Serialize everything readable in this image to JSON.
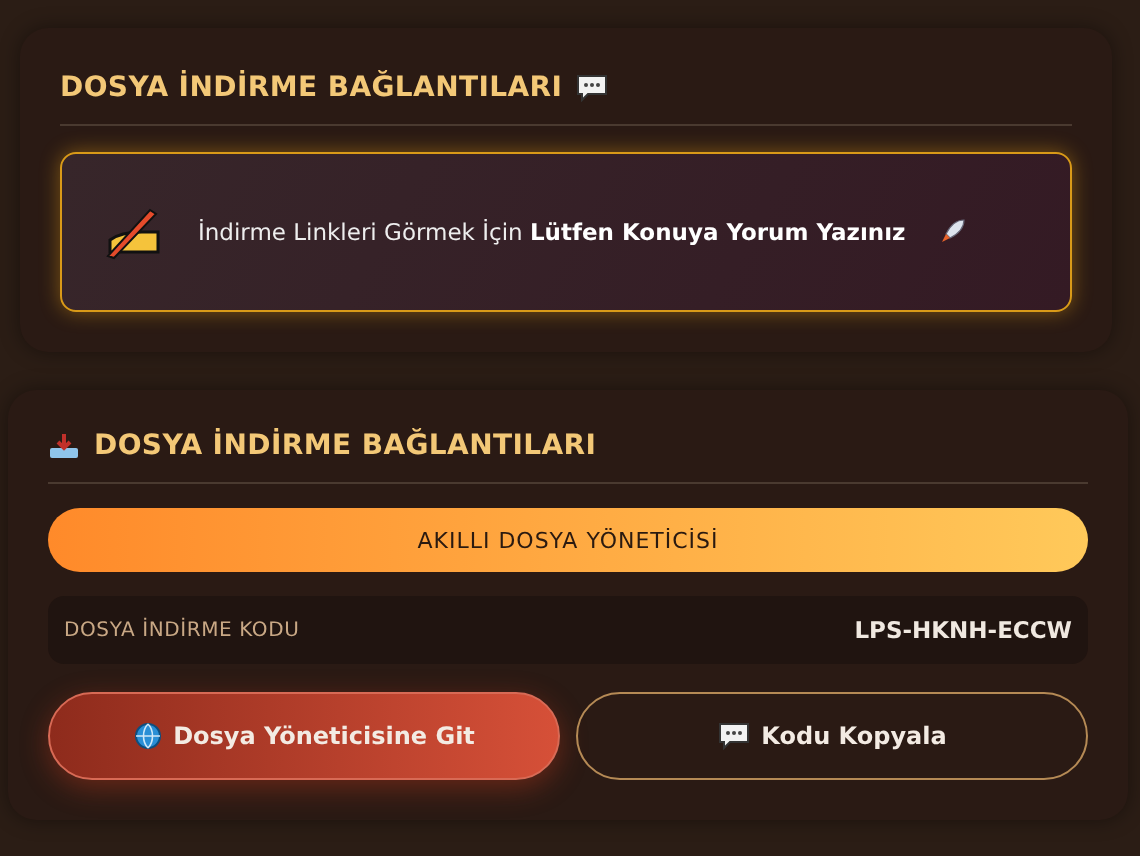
{
  "comment_panel": {
    "title": "DOSYA İNDİRME BAĞLANTILARI",
    "notice": "İndirme Linkleri Görmek İçin **Lütfen Konuya Yorum Yazınız**"
  },
  "download_panel": {
    "title": "DOSYA İNDİRME BAĞLANTILARI",
    "banner": "AKILLI DOSYA YÖNETİCİSİ",
    "code_label": "DOSYA İNDİRME KODU",
    "code_value": "LPS-HKNH-ECCW",
    "buttons": [
      {
        "label": "Dosya Yöneticisine Git",
        "kind": "primary"
      },
      {
        "label": "Kodu Kopyala",
        "kind": "outline"
      }
    ]
  }
}
